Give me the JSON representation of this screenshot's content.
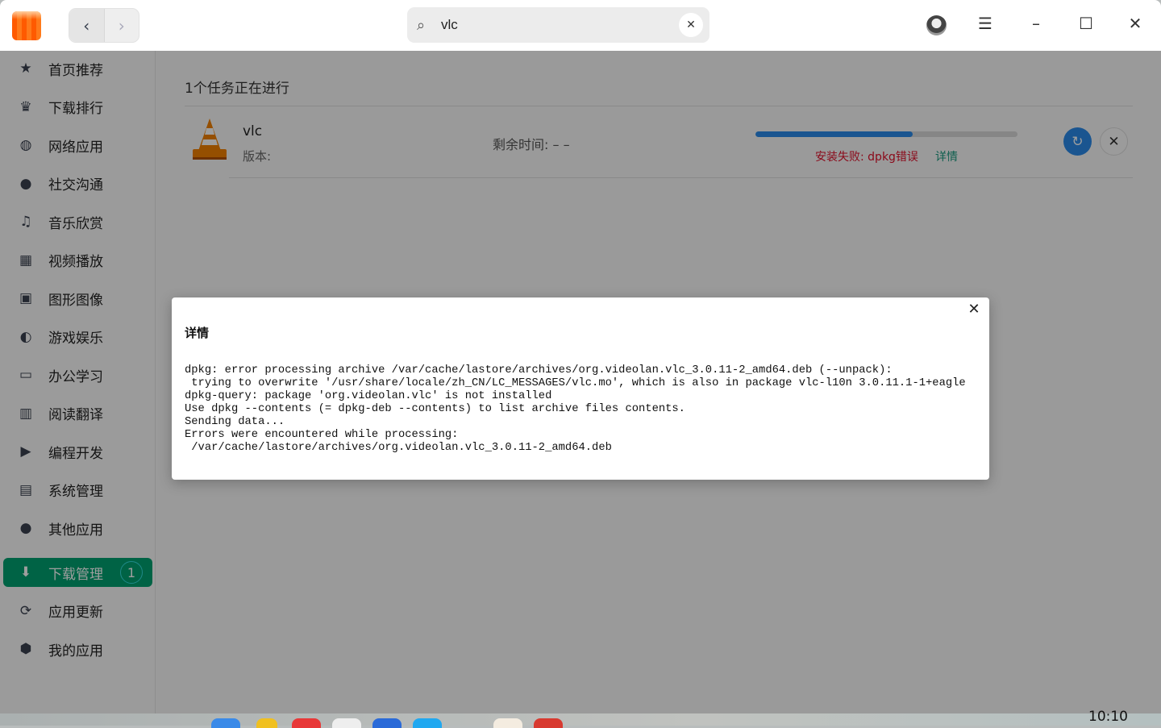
{
  "titlebar": {
    "back_icon": "chevron-left",
    "forward_icon": "chevron-right",
    "search_value": "vlc",
    "search_icon": "search-icon",
    "menu_icon": "hamburger-icon"
  },
  "sidebar": {
    "items": [
      {
        "label": "首页推荐",
        "icon": "★"
      },
      {
        "label": "下载排行",
        "icon": "♛"
      },
      {
        "label": "网络应用",
        "icon": "◍"
      },
      {
        "label": "社交沟通",
        "icon": "●"
      },
      {
        "label": "音乐欣赏",
        "icon": "♫"
      },
      {
        "label": "视频播放",
        "icon": "▦"
      },
      {
        "label": "图形图像",
        "icon": "▣"
      },
      {
        "label": "游戏娱乐",
        "icon": "◐"
      },
      {
        "label": "办公学习",
        "icon": "▭"
      },
      {
        "label": "阅读翻译",
        "icon": "▥"
      },
      {
        "label": "编程开发",
        "icon": "▶"
      },
      {
        "label": "系统管理",
        "icon": "▤"
      },
      {
        "label": "其他应用",
        "icon": "●"
      }
    ],
    "bottom": [
      {
        "label": "下载管理",
        "icon": "⬇",
        "badge": "1",
        "active": true
      },
      {
        "label": "应用更新",
        "icon": "⟳"
      },
      {
        "label": "我的应用",
        "icon": "⬢"
      }
    ]
  },
  "main": {
    "heading": "1个任务正在进行",
    "task": {
      "name": "vlc",
      "version_label": "版本:",
      "remaining": "剩余时间:  – –",
      "progress_percent": 60,
      "error": "安装失败: dpkg错误",
      "details_link": "详情"
    }
  },
  "dialog": {
    "title": "详情",
    "log": "dpkg: error processing archive /var/cache/lastore/archives/org.videolan.vlc_3.0.11-2_amd64.deb (--unpack):\n trying to overwrite '/usr/share/locale/zh_CN/LC_MESSAGES/vlc.mo', which is also in package vlc-l10n 3.0.11.1-1+eagle\ndpkg-query: package 'org.videolan.vlc' is not installed\nUse dpkg --contents (= dpkg-deb --contents) to list archive files contents.\nSending data...\nErrors were encountered while processing:\n /var/cache/lastore/archives/org.videolan.vlc_3.0.11-2_amd64.deb"
  },
  "dock": {
    "clock": "10:10"
  },
  "colors": {
    "accent": "#00a070",
    "progress": "#2a8ae8",
    "error": "#e0102a"
  }
}
